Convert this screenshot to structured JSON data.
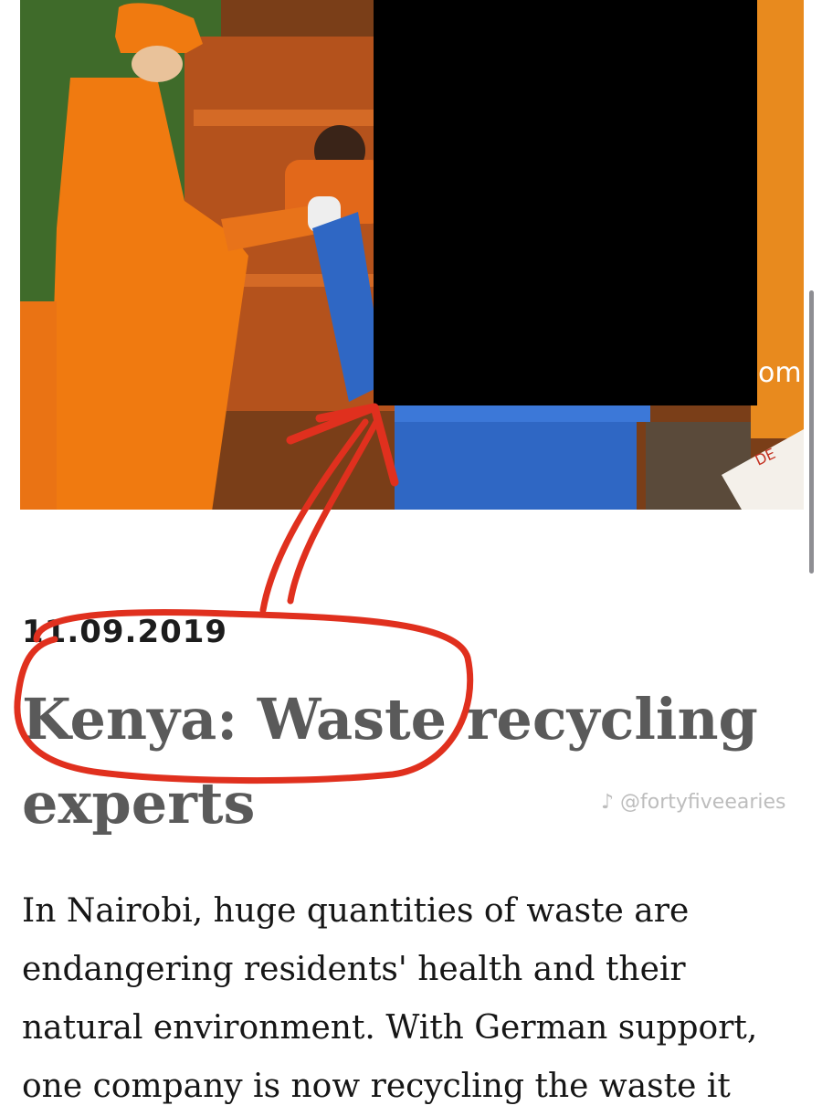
{
  "article": {
    "date": "11.09.2019",
    "title": "Kenya: Waste recycling experts",
    "lead": "In Nairobi, huge quantities of waste are endangering residents' health and their natural environment. With German support, one company is now recycling the waste it"
  },
  "photo": {
    "sign_text": "om",
    "crate_text": "DE"
  },
  "overlay": {
    "watermark": "♪ @fortyfiveearies"
  },
  "colors": {
    "annotation_red": "#e0301e",
    "title_gray": "#5a5a5a",
    "orange_coat": "#f07a10",
    "bin_blue": "#2f67c4",
    "redaction": "#000000"
  }
}
